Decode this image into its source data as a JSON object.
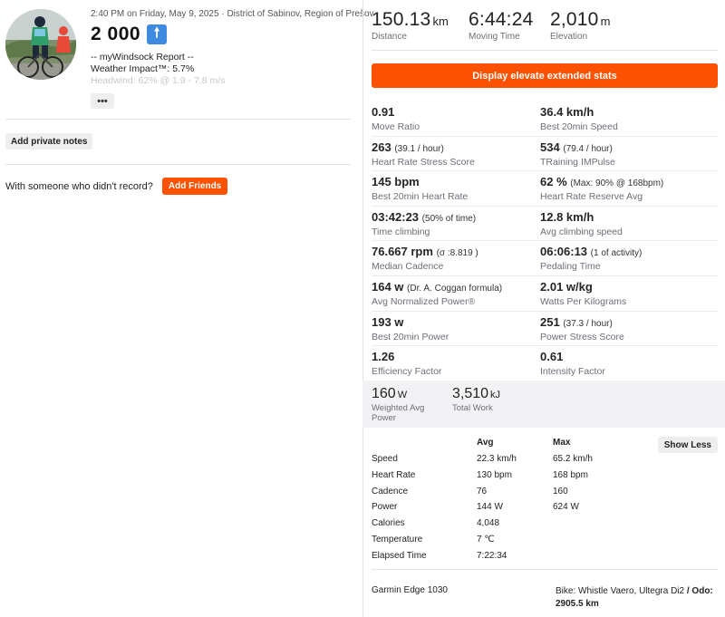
{
  "activity": {
    "meta": "2:40 PM on Friday, May 9, 2025 · District of Sabinov, Region of Prešov",
    "title": "2 000",
    "badge_icon": "arrow-up-icon",
    "description_lines": [
      "-- myWindsock Report --",
      "Weather Impact™: 5.7%",
      "Headwind: 62% @ 1.9 - 7.8 m/s"
    ],
    "more_label": "•••",
    "add_notes_label": "Add private notes",
    "friends_prompt": "With someone who didn't record?",
    "add_friends_label": "Add Friends"
  },
  "summary": [
    {
      "value": "150.13",
      "unit": "km",
      "label": "Distance"
    },
    {
      "value": "6:44:24",
      "unit": "",
      "label": "Moving Time"
    },
    {
      "value": "2,010",
      "unit": "m",
      "label": "Elevation"
    }
  ],
  "elevate_label": "Display elevate extended stats",
  "extended_stats": [
    [
      {
        "value": "0.91",
        "note": "",
        "label": "Move Ratio"
      },
      {
        "value": "36.4 km/h",
        "note": "",
        "label": "Best 20min Speed"
      }
    ],
    [
      {
        "value": "263",
        "note": "(39.1 / hour)",
        "label": "Heart Rate Stress Score"
      },
      {
        "value": "534",
        "note": "(79.4 / hour)",
        "label": "TRaining IMPulse"
      }
    ],
    [
      {
        "value": "145 bpm",
        "note": "",
        "label": "Best 20min Heart Rate"
      },
      {
        "value": "62 %",
        "note": "(Max: 90% @ 168bpm)",
        "label": "Heart Rate Reserve Avg"
      }
    ],
    [
      {
        "value": "03:42:23",
        "note": "(50% of time)",
        "label": "Time climbing"
      },
      {
        "value": "12.8 km/h",
        "note": "",
        "label": "Avg climbing speed"
      }
    ],
    [
      {
        "value": "76.667 rpm",
        "note": "(σ :8.819 )",
        "label": "Median Cadence"
      },
      {
        "value": "06:06:13",
        "note": "(1 of activity)",
        "label": "Pedaling Time"
      }
    ],
    [
      {
        "value": "164 w",
        "note": "(Dr. A. Coggan formula)",
        "label": "Avg Normalized Power®"
      },
      {
        "value": "2.01 w/kg",
        "note": "",
        "label": "Watts Per Kilograms"
      }
    ],
    [
      {
        "value": "193 w",
        "note": "",
        "label": "Best 20min Power"
      },
      {
        "value": "251",
        "note": "(37.3 / hour)",
        "label": "Power Stress Score"
      }
    ],
    [
      {
        "value": "1.26",
        "note": "",
        "label": "Efficiency Factor"
      },
      {
        "value": "0.61",
        "note": "",
        "label": "Intensity Factor"
      }
    ]
  ],
  "weighted": [
    {
      "value": "160",
      "unit": "W",
      "label": "Weighted Avg Power"
    },
    {
      "value": "3,510",
      "unit": "kJ",
      "label": "Total Work"
    }
  ],
  "detail_table": {
    "headers": {
      "avg": "Avg",
      "max": "Max"
    },
    "show_less_label": "Show Less",
    "rows": [
      {
        "label": "Speed",
        "avg": "22.3 km/h",
        "max": "65.2 km/h"
      },
      {
        "label": "Heart Rate",
        "avg": "130 bpm",
        "max": "168 bpm"
      },
      {
        "label": "Cadence",
        "avg": "76",
        "max": "160"
      },
      {
        "label": "Power",
        "avg": "144 W",
        "max": "624 W"
      },
      {
        "label": "Calories",
        "avg": "4,048",
        "max": ""
      },
      {
        "label": "Temperature",
        "avg": "7 ℃",
        "max": ""
      },
      {
        "label": "Elapsed Time",
        "avg": "7:22:34",
        "max": ""
      }
    ]
  },
  "device": "Garmin Edge 1030",
  "bike": {
    "text": "Bike: Whistle Vaero, Ultegra Di2",
    "odo_label": "/ Odo:",
    "odo_value": "2905.5 km"
  },
  "colors": {
    "accent": "#fc5200",
    "badge": "#3d8ae0"
  }
}
